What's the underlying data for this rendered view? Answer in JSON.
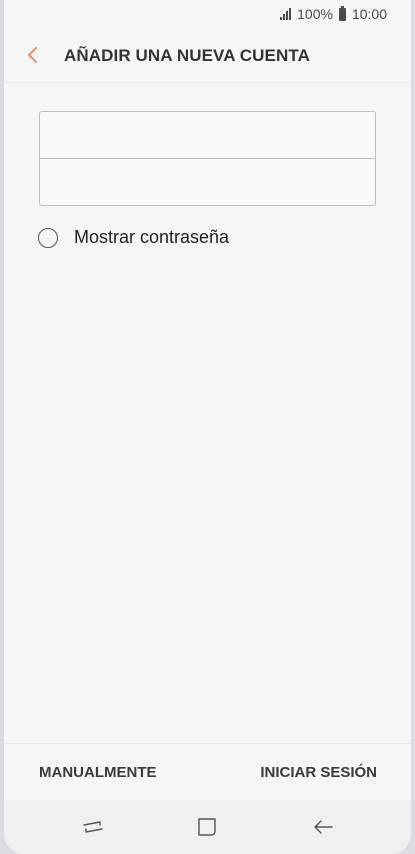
{
  "status": {
    "battery": "100%",
    "time": "10:00"
  },
  "header": {
    "title": "AÑADIR UNA NUEVA CUENTA"
  },
  "form": {
    "field1_value": "",
    "field2_value": "",
    "show_password_label": "Mostrar contraseña"
  },
  "actions": {
    "manual_label": "MANUALMENTE",
    "signin_label": "INICIAR SESIÓN"
  },
  "icons": {
    "back": "chevron-left-icon",
    "recent": "recent-apps-icon",
    "home": "home-icon",
    "nav_back": "back-arrow-icon"
  },
  "colors": {
    "accent": "#e8926a",
    "background": "#f7f6f7"
  }
}
